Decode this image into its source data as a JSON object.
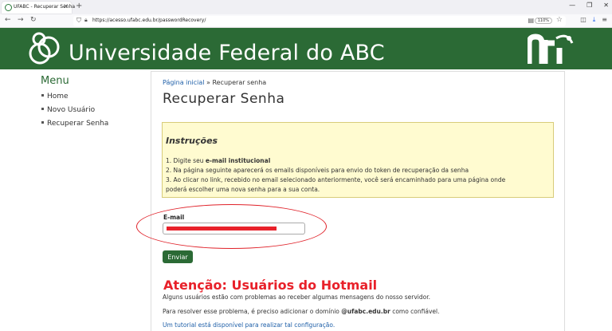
{
  "browser": {
    "tab_title": "UFABC - Recuperar Senha",
    "url": "https://acesso.ufabc.edu.br/passwordRecovery/",
    "zoom": "110%"
  },
  "header": {
    "title": "Universidade Federal do ABC",
    "brand_color": "#2b6a35"
  },
  "sidebar": {
    "title": "Menu",
    "items": [
      {
        "label": "Home"
      },
      {
        "label": "Novo Usuário"
      },
      {
        "label": "Recuperar Senha"
      }
    ]
  },
  "main": {
    "breadcrumb_home": "Página inicial",
    "breadcrumb_sep": " » ",
    "breadcrumb_current": "Recuperar senha",
    "page_title": "Recuperar Senha",
    "instructions_title": "Instruções",
    "instr_1_prefix": "1. Digite seu ",
    "instr_1_bold": "e-mail institucional",
    "instr_2": "2. Na página seguinte aparecerá os emails disponíveis para envio do token de recuperação da senha",
    "instr_3a": "3. Ao clicar no link, recebido no email selecionado anteriormente, você será encaminhado para uma página onde",
    "instr_3b": "poderá escolher uma nova senha para a sua conta.",
    "email_label": "E-mail",
    "email_value": "",
    "send_label": "Enviar",
    "warn_title": "Atenção: Usuários do Hotmail",
    "warn_p1": "Alguns usuários estão com problemas ao receber algumas mensagens do nosso servidor.",
    "warn_p2_prefix": "Para resolver esse problema, é preciso adicionar o domínio ",
    "warn_p2_bold": "@ufabc.edu.br",
    "warn_p2_suffix": " como confiável.",
    "warn_link": "Um tutorial está disponível para realizar tal configuração."
  },
  "colors": {
    "warning": "#e8212a",
    "link": "#1e5fa8",
    "instructions_bg": "#fffbd0"
  }
}
